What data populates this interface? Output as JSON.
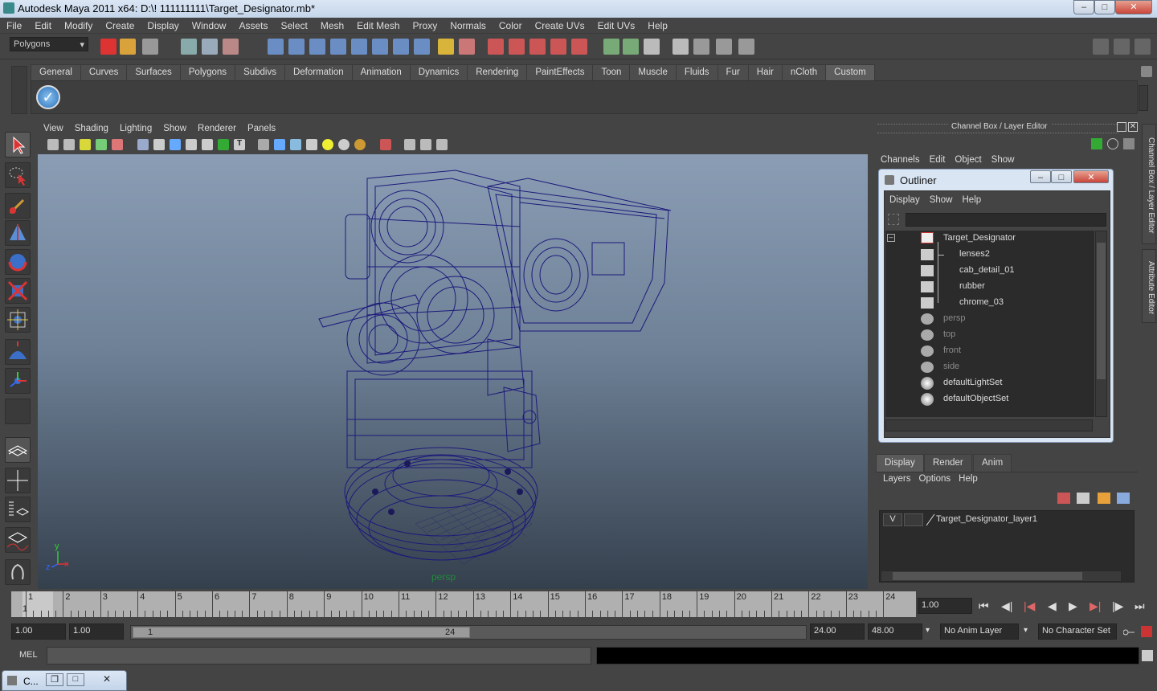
{
  "window": {
    "title": "Autodesk Maya 2011 x64: D:\\! 111111111\\Target_Designator.mb*"
  },
  "menu": [
    "File",
    "Edit",
    "Modify",
    "Create",
    "Display",
    "Window",
    "Assets",
    "Select",
    "Mesh",
    "Edit Mesh",
    "Proxy",
    "Normals",
    "Color",
    "Create UVs",
    "Edit UVs",
    "Help"
  ],
  "statusline": {
    "menu_set": "Polygons"
  },
  "shelf": {
    "tabs": [
      "General",
      "Curves",
      "Surfaces",
      "Polygons",
      "Subdivs",
      "Deformation",
      "Animation",
      "Dynamics",
      "Rendering",
      "PaintEffects",
      "Toon",
      "Muscle",
      "Fluids",
      "Fur",
      "Hair",
      "nCloth",
      "Custom"
    ],
    "active": "Custom"
  },
  "panel": {
    "menu": [
      "View",
      "Shading",
      "Lighting",
      "Show",
      "Renderer",
      "Panels"
    ],
    "camera_label": "persp"
  },
  "axis": {
    "y": "y",
    "x": "x",
    "z": "z"
  },
  "channel_box": {
    "title": "Channel Box / Layer Editor",
    "menu": [
      "Channels",
      "Edit",
      "Object",
      "Show"
    ]
  },
  "side_tabs": [
    "Channel Box / Layer Editor",
    "Attribute Editor"
  ],
  "outliner": {
    "title": "Outliner",
    "menu": [
      "Display",
      "Show",
      "Help"
    ],
    "items": [
      {
        "label": "Target_Designator",
        "dim": false
      },
      {
        "label": "lenses2",
        "dim": false
      },
      {
        "label": "cab_detail_01",
        "dim": false
      },
      {
        "label": "rubber",
        "dim": false
      },
      {
        "label": "chrome_03",
        "dim": false
      },
      {
        "label": "persp",
        "dim": true
      },
      {
        "label": "top",
        "dim": true
      },
      {
        "label": "front",
        "dim": true
      },
      {
        "label": "side",
        "dim": true
      },
      {
        "label": "defaultLightSet",
        "dim": false
      },
      {
        "label": "defaultObjectSet",
        "dim": false
      }
    ]
  },
  "layers": {
    "tabs": [
      "Display",
      "Render",
      "Anim"
    ],
    "menu": [
      "Layers",
      "Options",
      "Help"
    ],
    "row": {
      "visible": "V",
      "name": "Target_Designator_layer1"
    }
  },
  "timeline": {
    "ticks": [
      "1",
      "2",
      "3",
      "4",
      "5",
      "6",
      "7",
      "8",
      "9",
      "10",
      "11",
      "12",
      "13",
      "14",
      "15",
      "16",
      "17",
      "18",
      "19",
      "20",
      "21",
      "22",
      "23",
      "24"
    ],
    "current_frame": "1",
    "current_field": "1.00"
  },
  "range": {
    "start": "1.00",
    "start2": "1.00",
    "slider_start": "1",
    "slider_end": "24",
    "end": "24.00",
    "end2": "48.00",
    "anim_layer": "No Anim Layer",
    "char_set": "No Character Set"
  },
  "mel": {
    "label": "MEL"
  },
  "taskbar": {
    "label": "C..."
  }
}
